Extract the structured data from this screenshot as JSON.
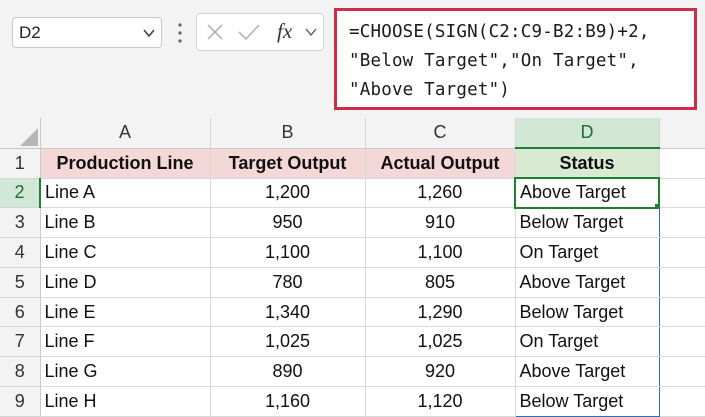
{
  "name_box": {
    "value": "D2"
  },
  "formula_bar": {
    "fx_label": "fx",
    "formula_lines": [
      "=CHOOSE(SIGN(C2:C9-B2:B9)+2,",
      "\"Below Target\",\"On Target\",",
      "\"Above Target\")"
    ]
  },
  "columns": [
    "A",
    "B",
    "C",
    "D"
  ],
  "active_cell": "D2",
  "header_row": {
    "row_number": "1",
    "cells": [
      "Production Line",
      "Target Output",
      "Actual Output",
      "Status"
    ]
  },
  "rows": [
    {
      "row_number": "2",
      "line": "Line A",
      "target": "1,200",
      "actual": "1,260",
      "status": "Above Target"
    },
    {
      "row_number": "3",
      "line": "Line B",
      "target": "950",
      "actual": "910",
      "status": "Below Target"
    },
    {
      "row_number": "4",
      "line": "Line C",
      "target": "1,100",
      "actual": "1,100",
      "status": "On Target"
    },
    {
      "row_number": "5",
      "line": "Line D",
      "target": "780",
      "actual": "805",
      "status": "Above Target"
    },
    {
      "row_number": "6",
      "line": "Line E",
      "target": "1,340",
      "actual": "1,290",
      "status": "Below Target"
    },
    {
      "row_number": "7",
      "line": "Line F",
      "target": "1,025",
      "actual": "1,025",
      "status": "On Target"
    },
    {
      "row_number": "8",
      "line": "Line G",
      "target": "890",
      "actual": "920",
      "status": "Above Target"
    },
    {
      "row_number": "9",
      "line": "Line H",
      "target": "1,160",
      "actual": "1,120",
      "status": "Below Target"
    }
  ],
  "colors": {
    "formula_highlight": "#cc2e4a",
    "header_fill": "#f4d7d7",
    "status_header_fill": "#d9ead3",
    "selection_green": "#1e7e34",
    "range_border_blue": "#2f6fb5"
  }
}
